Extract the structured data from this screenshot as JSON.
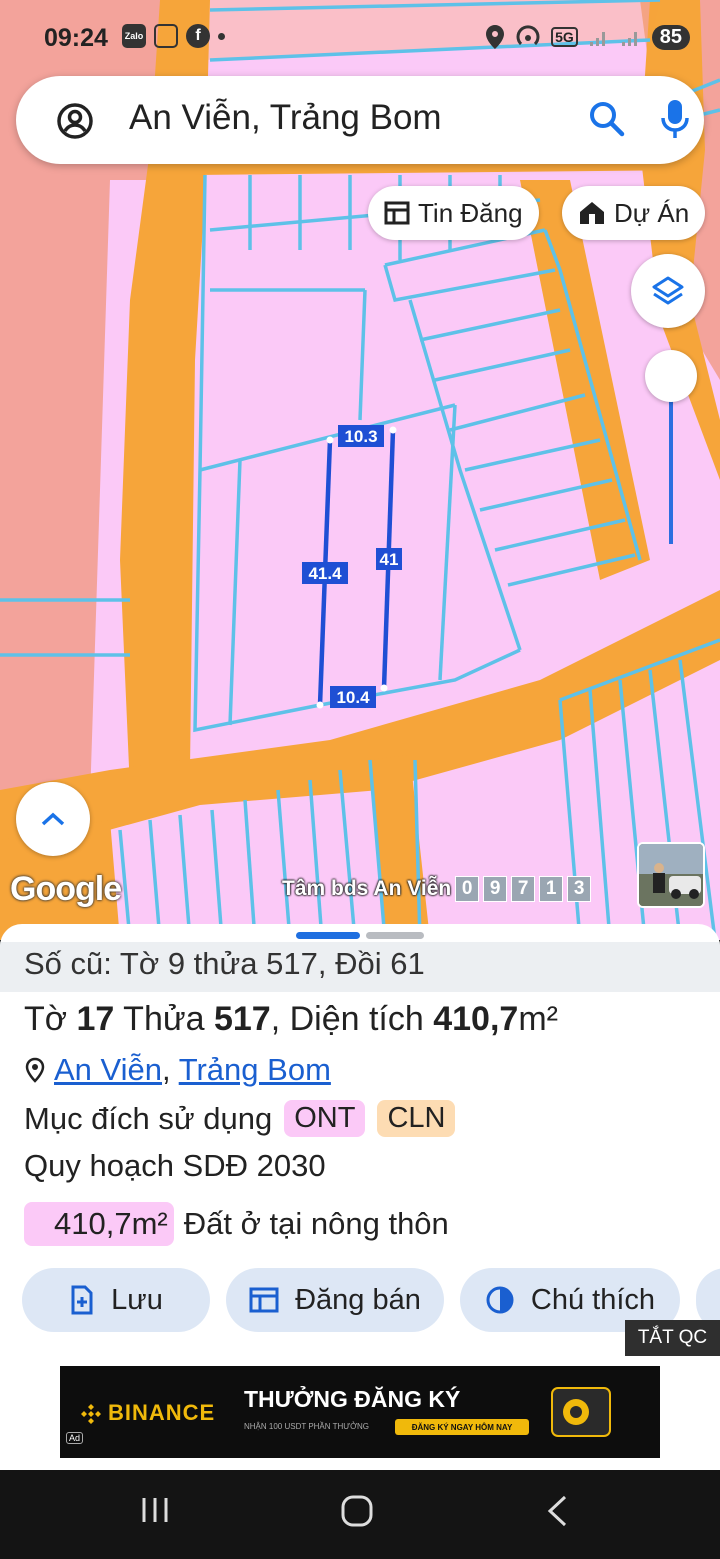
{
  "status_bar": {
    "time": "09:24",
    "app_icons": [
      "zalo-icon",
      "scan-icon",
      "facebook-icon",
      "dot-icon"
    ],
    "zalo_label": "Zalo",
    "network": "5G",
    "battery": "85"
  },
  "search": {
    "query": "An Viễn, Trảng Bom"
  },
  "chips": {
    "listings": "Tin Đăng",
    "projects": "Dự Án"
  },
  "map": {
    "measurements": {
      "top": "10.3",
      "left": "41.4",
      "right": "41",
      "bottom": "10.4"
    },
    "google_label": "Google",
    "watermark_text": "Tâm bds An Viễn",
    "watermark_digits": [
      "0",
      "9",
      "7",
      "1",
      "3"
    ],
    "colors": {
      "road": "#f6a53a",
      "parcel": "#fbc9f7",
      "residential": "#f3a39b",
      "parcel_border": "#5ec1e8",
      "measure_line": "#1f4fd4"
    }
  },
  "panel": {
    "old_number": "Số cũ: Tờ 9 thửa 517, Đồi 61",
    "title": {
      "sheet_label": "Tờ ",
      "sheet": "17",
      "parcel_label": " Thửa ",
      "parcel": "517",
      "area_label": ", Diện tích ",
      "area": "410,7",
      "unit": "m²"
    },
    "location": {
      "commune": "An Viễn",
      "separator": ",",
      "district": "Trảng Bom"
    },
    "purpose_label": "Mục đích sử dụng",
    "purpose_tags": [
      {
        "code": "ONT",
        "color": "#fbc9f7"
      },
      {
        "code": "CLN",
        "color": "#fddcb3"
      }
    ],
    "plan_label": "Quy hoạch SDĐ 2030",
    "plan_area": "410,7m²",
    "plan_type": "Đất ở tại nông thôn",
    "plan_color": "#fbc9f7",
    "actions": [
      {
        "label": "Lưu",
        "icon": "bookmark-add-icon"
      },
      {
        "label": "Đăng bán",
        "icon": "post-icon"
      },
      {
        "label": "Chú thích",
        "icon": "legend-icon"
      }
    ],
    "hide_ads": "TẮT QC"
  },
  "ad": {
    "brand": "BINANCE",
    "headline": "THƯỞNG ĐĂNG KÝ",
    "sub": "NHẬN 100 USDT PHẦN THƯỞNG",
    "cta": "ĐĂNG KÝ NGAY HÔM NAY",
    "badge": "Ad"
  }
}
